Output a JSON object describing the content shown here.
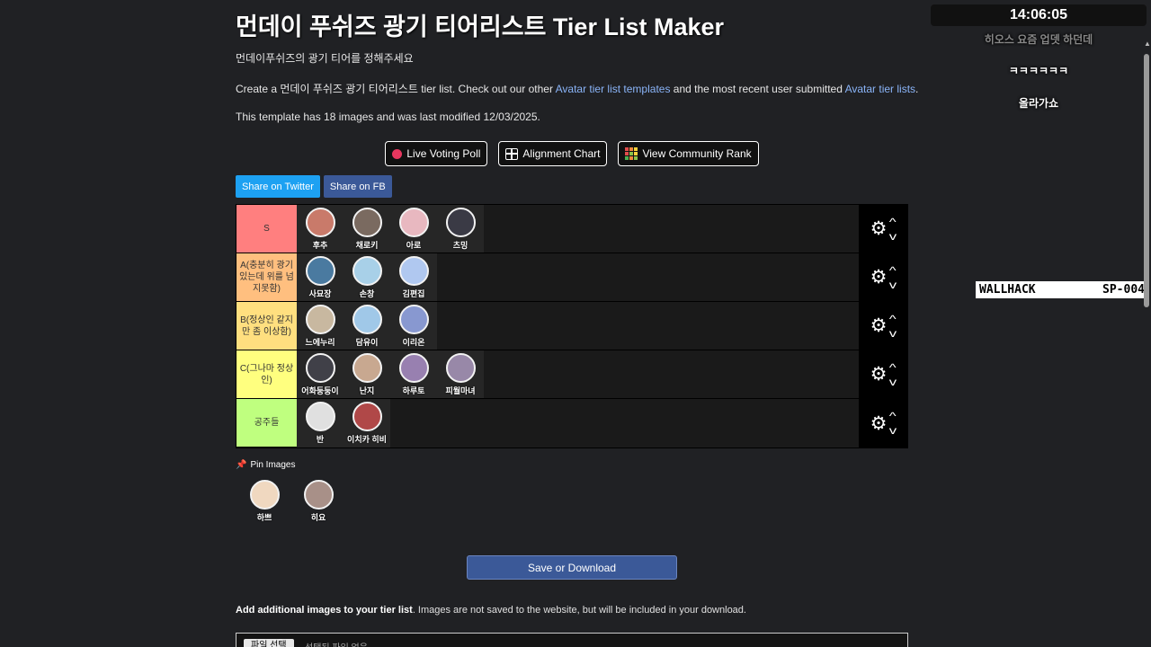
{
  "page": {
    "title": "먼데이 푸쉬즈 광기 티어리스트 Tier List Maker",
    "subtitle": "먼데이푸쉬즈의 광기 티어를 정해주세요",
    "desc_prefix": "Create a 먼데이 푸쉬즈 광기 티어리스트 tier list. Check out our other ",
    "desc_link1": "Avatar tier list templates",
    "desc_middle": " and the most recent user submitted ",
    "desc_link2": "Avatar tier lists",
    "desc_suffix": ".",
    "meta": "This template has 18 images and was last modified 12/03/2025."
  },
  "actions": {
    "live_voting": "Live Voting Poll",
    "alignment": "Alignment Chart",
    "community_rank": "View Community Rank",
    "share_twitter": "Share on Twitter",
    "share_fb": "Share on FB"
  },
  "tiers": [
    {
      "label": "S",
      "color": "#ff7f7f",
      "items": [
        {
          "name": "후추",
          "color": "#c97a6a"
        },
        {
          "name": "채로키",
          "color": "#7a6a60"
        },
        {
          "name": "아로",
          "color": "#e8b8c0"
        },
        {
          "name": "츠밍",
          "color": "#3a3a45"
        }
      ]
    },
    {
      "label": "A(충분히 광기 있는데 위를 넘지못함)",
      "color": "#ffbf7f",
      "items": [
        {
          "name": "사묘장",
          "color": "#4a7aa0"
        },
        {
          "name": "손창",
          "color": "#a8d0e8"
        },
        {
          "name": "김편집",
          "color": "#b0c8f0"
        }
      ]
    },
    {
      "label": "B(정상인 같지만 좀 이상함)",
      "color": "#ffdf7f",
      "items": [
        {
          "name": "느에누리",
          "color": "#c8b8a0"
        },
        {
          "name": "담유이",
          "color": "#a0c8e8"
        },
        {
          "name": "이리온",
          "color": "#8898d0"
        }
      ]
    },
    {
      "label": "C(그나마 정상인)",
      "color": "#ffff7f",
      "items": [
        {
          "name": "어화둥둥이",
          "color": "#404048"
        },
        {
          "name": "난지",
          "color": "#c8a890"
        },
        {
          "name": "하루토",
          "color": "#9880b0"
        },
        {
          "name": "피월마녀",
          "color": "#9888a8"
        }
      ]
    },
    {
      "label": "공주들",
      "color": "#bfff7f",
      "items": [
        {
          "name": "반",
          "color": "#e0e0e0"
        },
        {
          "name": "이치카 히비",
          "color": "#b04848"
        }
      ]
    }
  ],
  "pin": {
    "label": "Pin Images",
    "items": [
      {
        "name": "하쁘",
        "color": "#f0d8c0"
      },
      {
        "name": "히요",
        "color": "#a89088"
      }
    ]
  },
  "save_label": "Save or Download",
  "add": {
    "bold": "Add additional images to your tier list",
    "rest": ". Images are not saved to the website, but will be included in your download.",
    "file_button": "파일 선택",
    "file_status": "선택된 파일 없음"
  },
  "overlay": {
    "clock": "14:06:05",
    "chat1": "히오스 요즘 업뎃 하던데",
    "chat2": "ㅋㅋㅋㅋㅋㅋ",
    "chat3": "올라가쇼",
    "wallhack_left": "WALLHACK",
    "wallhack_right": "SP-004"
  },
  "rank_colors": [
    "#e04b4b",
    "#f08a3c",
    "#f5d33c",
    "#e04b4b",
    "#8bc34a",
    "#f5d33c",
    "#4caf50",
    "#f08a3c",
    "#8bc34a"
  ]
}
